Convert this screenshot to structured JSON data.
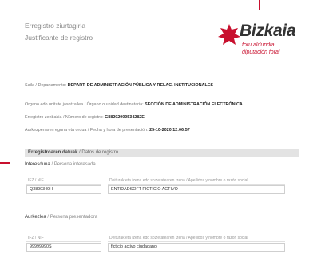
{
  "header": {
    "title": "Erregistro ziurtagiria",
    "subtitle": "Justificante de registro"
  },
  "logo": {
    "word": "Bizkaia",
    "line1": "foru aldundia",
    "line2": "diputación foral",
    "brand_color": "#c8102e"
  },
  "meta": {
    "saila_k": "Saila / Departamento:",
    "saila_v": "DEPART. DE ADMINISTRACIÓN PÚBLICA Y RELAC. INSTITUCIONALES",
    "organo_k": "Organo edo unitate jasotzailea / Órgano o unidad destinataria:",
    "organo_v": "SECCIÓN DE ADMINISTRACIÓN ELECTRÓNICA",
    "zenbakia_k": "Erregistro zenbakia / Número de registro:",
    "zenbakia_v": "G88202000534282E",
    "data_k": "Aurkezpenaren eguna eta ordua / Fecha y hora de presentación:",
    "data_v": "25-10-2020 12:06:57"
  },
  "section_bar": {
    "k": "Erregistroaren datuak",
    "v": "/ Datos de registro"
  },
  "interested": {
    "title_k": "Interesduna",
    "title_v": "/ Persona interesada",
    "nif_label": "IFZ / NIF",
    "name_label": "Deiturak eta izena edo sozietatearen izena / Apellidos y nombre o razón social",
    "nif_value": "Q3890349H",
    "name_value": "ENTIDADSOFT FICTICIO ACTIVO"
  },
  "presenter": {
    "title_k": "Aurkezlea",
    "title_v": "/ Persona presentadora",
    "nif_label": "IFZ / NIF",
    "name_label": "Deiturak eta izena edo sozietatearen izena / Apellidos y nombre o razón social",
    "nif_value": "99999990S",
    "name_value": "ficticio activo ciudadano"
  }
}
